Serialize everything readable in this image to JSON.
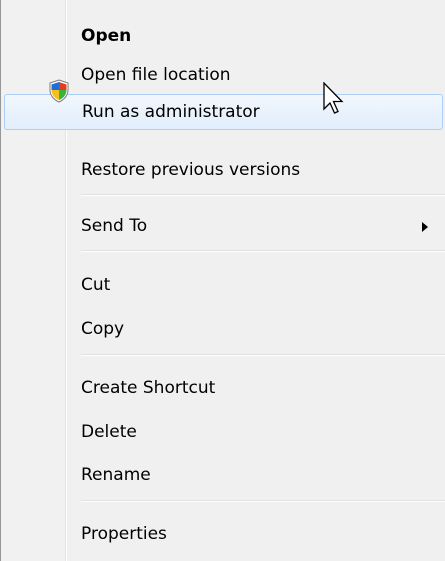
{
  "menu": {
    "items": [
      {
        "label": "Open"
      },
      {
        "label": "Open file location"
      },
      {
        "label": "Run as administrator"
      },
      {
        "label": "Restore previous versions"
      },
      {
        "label": "Send To"
      },
      {
        "label": "Cut"
      },
      {
        "label": "Copy"
      },
      {
        "label": "Create Shortcut"
      },
      {
        "label": "Delete"
      },
      {
        "label": "Rename"
      },
      {
        "label": "Properties"
      }
    ],
    "highlighted_item": "Run as administrator",
    "default_item": "Open",
    "submenu_item": "Send To"
  },
  "icons": {
    "run_as_admin": "uac-shield-icon",
    "send_to": "submenu-arrow-icon",
    "pointer": "mouse-cursor-icon"
  },
  "colors": {
    "menu_background": "#f0f0f0",
    "highlight_border": "#aecff7",
    "highlight_fill": "#e1eefc",
    "separator": "#e0e0e0"
  }
}
